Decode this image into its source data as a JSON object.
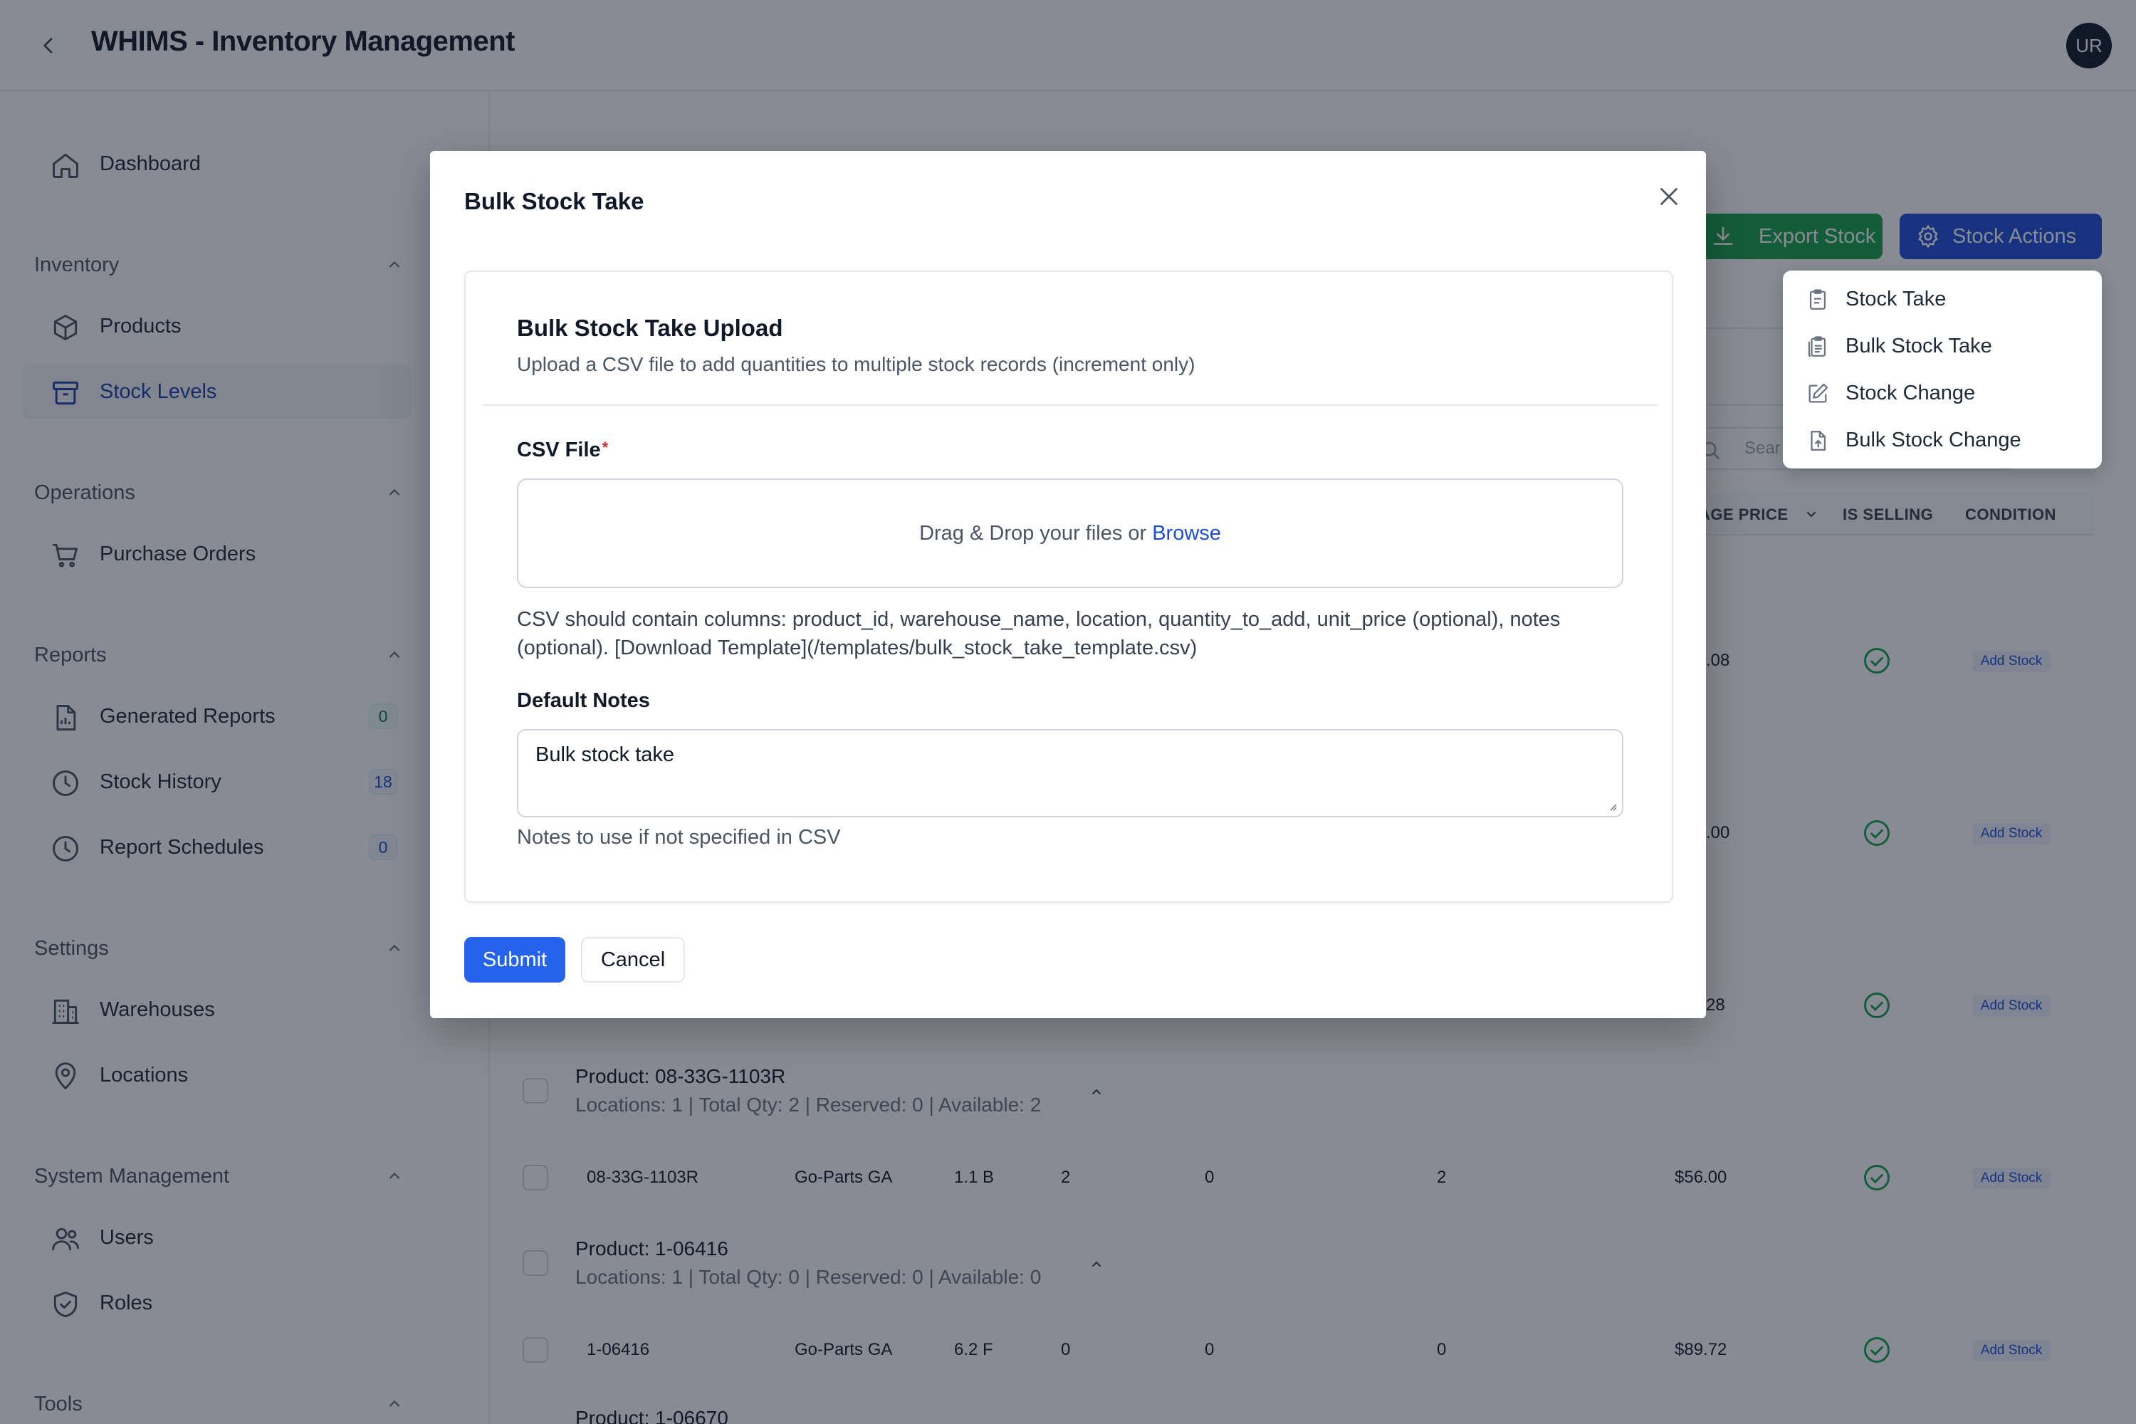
{
  "header": {
    "title": "WHIMS - Inventory Management",
    "avatar_initials": "UR"
  },
  "sidebar": {
    "dashboard": "Dashboard",
    "sections": {
      "inventory": "Inventory",
      "operations": "Operations",
      "reports": "Reports",
      "settings": "Settings",
      "system": "System Management",
      "tools": "Tools"
    },
    "items": {
      "products": "Products",
      "stock_levels": "Stock Levels",
      "purchase_orders": "Purchase Orders",
      "generated_reports": "Generated Reports",
      "generated_reports_count": "0",
      "stock_history": "Stock History",
      "stock_history_count": "18",
      "report_schedules": "Report Schedules",
      "report_schedules_count": "0",
      "warehouses": "Warehouses",
      "locations": "Locations",
      "users": "Users",
      "roles": "Roles"
    }
  },
  "toolbar": {
    "export_label": "Export Stock",
    "actions_label": "Stock Actions",
    "search_placeholder": "Sear"
  },
  "dropdown": {
    "stock_take": "Stock Take",
    "bulk_stock_take": "Bulk Stock Take",
    "stock_change": "Stock Change",
    "bulk_stock_change": "Bulk Stock Change"
  },
  "table": {
    "headers": {
      "avg_price": "AGE PRICE",
      "is_selling": "IS SELLING",
      "condition": "CONDITION"
    },
    "partial_prices": [
      ".08",
      ".00",
      "28"
    ],
    "add_stock": "Add Stock",
    "groups": [
      {
        "title": "Product: 08-33G-1103R",
        "summary": "Locations: 1 | Total Qty: 2 | Reserved: 0 | Available: 2",
        "row": {
          "sku": "08-33G-1103R",
          "warehouse": "Go-Parts GA",
          "location": "1.1 B",
          "qty": "2",
          "reserved": "0",
          "available": "2",
          "price": "$56.00"
        }
      },
      {
        "title": "Product: 1-06416",
        "summary": "Locations: 1 | Total Qty: 0 | Reserved: 0 | Available: 0",
        "row": {
          "sku": "1-06416",
          "warehouse": "Go-Parts GA",
          "location": "6.2 F",
          "qty": "0",
          "reserved": "0",
          "available": "0",
          "price": "$89.72"
        }
      },
      {
        "title": "Product: 1-06670"
      }
    ]
  },
  "modal": {
    "title": "Bulk Stock Take",
    "card_title": "Bulk Stock Take Upload",
    "card_subtitle": "Upload a CSV file to add quantities to multiple stock records (increment only)",
    "csv_label": "CSV File",
    "required_mark": "*",
    "dropzone_text": "Drag & Drop your files or",
    "browse": "Browse",
    "csv_help": "CSV should contain columns: product_id, warehouse_name, location, quantity_to_add, unit_price (optional), notes (optional). [Download Template](/templates/bulk_stock_take_template.csv)",
    "notes_label": "Default Notes",
    "notes_value": "Bulk stock take",
    "notes_hint": "Notes to use if not specified in CSV",
    "submit": "Submit",
    "cancel": "Cancel"
  }
}
